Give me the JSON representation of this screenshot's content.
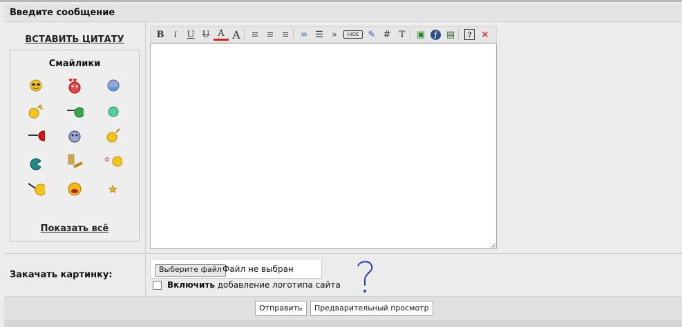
{
  "header": {
    "title": "Введите сообщение"
  },
  "left": {
    "quote_link": "ВСТАВИТЬ ЦИТАТУ",
    "smilies_title": "Смайлики",
    "show_all": "Показать всё",
    "smilies": [
      "cool-smiley",
      "love-smiley",
      "crying-smiley",
      "thinking-smiley",
      "sniper-smiley",
      "plain-smiley",
      "pacman-smiley",
      "confused-smiley",
      "hooray-smiley",
      "pac-smiley",
      "clapping-smiley",
      "flower-smiley",
      "jumping-smiley",
      "laughing-smiley",
      "star-smiley"
    ]
  },
  "toolbar": {
    "bold": "B",
    "italic": "i",
    "underline": "U",
    "strike": "U",
    "color": "A",
    "size": "A",
    "align_left": "≡",
    "align_center": "≡",
    "align_right": "≡",
    "link": "∞",
    "list": "☰",
    "quote": "»",
    "hide": "HIDE",
    "edit": "✎",
    "hash": "#",
    "text": "T",
    "image": "▣",
    "flash": "ƒ",
    "video": "▤",
    "help": "?",
    "close": "×"
  },
  "upload": {
    "label": "Закачать картинку:",
    "choose_button": "Выберите файл",
    "file_status": "Файл не выбран",
    "logo_bold": "Включить",
    "logo_text": " добавление логотипа сайта"
  },
  "actions": {
    "submit": "Отправить",
    "preview": "Предварительный просмотр"
  },
  "colors": {
    "bg": "#ececec",
    "header": "#e4e4e4",
    "accent_red": "#d22"
  }
}
